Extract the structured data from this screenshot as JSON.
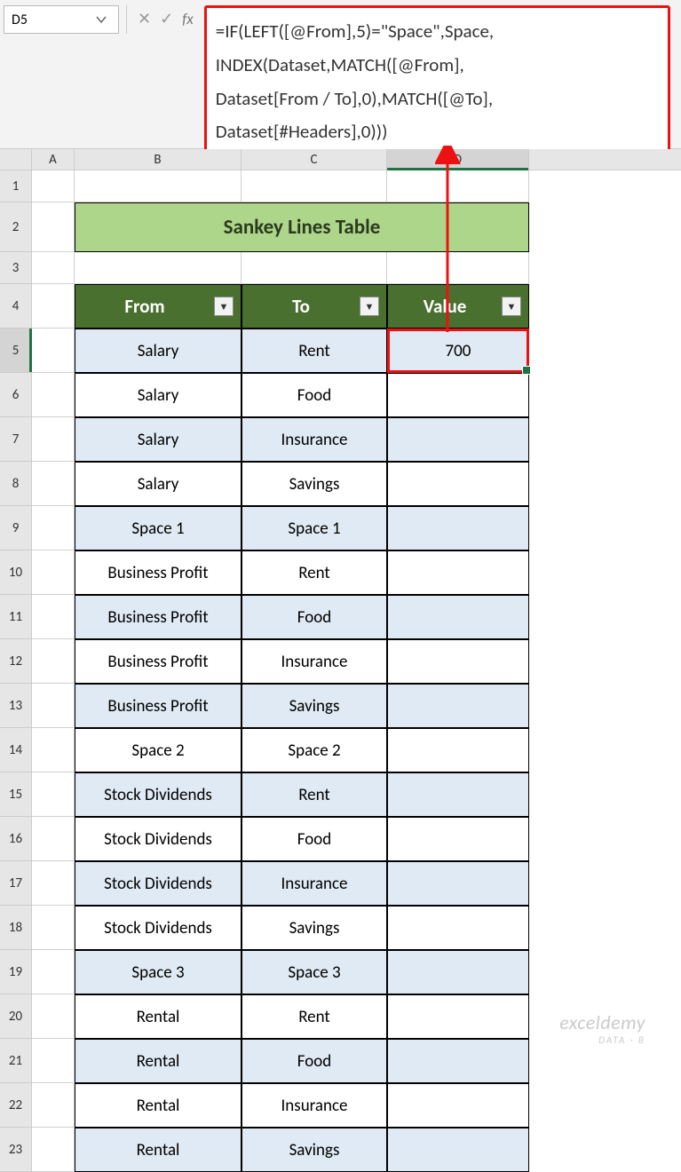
{
  "namebox": {
    "cell_ref": "D5"
  },
  "fx": {
    "cancel": "✕",
    "confirm": "✓",
    "label": "fx"
  },
  "formula": {
    "line1": "=IF(LEFT([@From],5)=\"Space\",Space,",
    "line2": "INDEX(Dataset,MATCH([@From],",
    "line3": "Dataset[From / To],0),MATCH([@To],",
    "line4": "Dataset[#Headers],0)))"
  },
  "cols": {
    "A": "A",
    "B": "B",
    "C": "C",
    "D": "D"
  },
  "row_labels": [
    "1",
    "2",
    "3",
    "4",
    "5",
    "6",
    "7",
    "8",
    "9",
    "10",
    "11",
    "12",
    "13",
    "14",
    "15",
    "16",
    "17",
    "18",
    "19",
    "20",
    "21",
    "22",
    "23"
  ],
  "banner": "Sankey Lines Table",
  "headers": {
    "from": "From",
    "to": "To",
    "value": "Value"
  },
  "rows": [
    {
      "from": "Salary",
      "to": "Rent",
      "value": "700",
      "band": true
    },
    {
      "from": "Salary",
      "to": "Food",
      "value": "",
      "band": false
    },
    {
      "from": "Salary",
      "to": "Insurance",
      "value": "",
      "band": true
    },
    {
      "from": "Salary",
      "to": "Savings",
      "value": "",
      "band": false
    },
    {
      "from": "Space 1",
      "to": "Space 1",
      "value": "",
      "band": true
    },
    {
      "from": "Business Profit",
      "to": "Rent",
      "value": "",
      "band": false
    },
    {
      "from": "Business Profit",
      "to": "Food",
      "value": "",
      "band": true
    },
    {
      "from": "Business Profit",
      "to": "Insurance",
      "value": "",
      "band": false
    },
    {
      "from": "Business Profit",
      "to": "Savings",
      "value": "",
      "band": true
    },
    {
      "from": "Space 2",
      "to": "Space 2",
      "value": "",
      "band": false
    },
    {
      "from": "Stock Dividends",
      "to": "Rent",
      "value": "",
      "band": true
    },
    {
      "from": "Stock Dividends",
      "to": "Food",
      "value": "",
      "band": false
    },
    {
      "from": "Stock Dividends",
      "to": "Insurance",
      "value": "",
      "band": true
    },
    {
      "from": "Stock Dividends",
      "to": "Savings",
      "value": "",
      "band": false
    },
    {
      "from": "Space 3",
      "to": "Space 3",
      "value": "",
      "band": true
    },
    {
      "from": "Rental",
      "to": "Rent",
      "value": "",
      "band": false
    },
    {
      "from": "Rental",
      "to": "Food",
      "value": "",
      "band": true
    },
    {
      "from": "Rental",
      "to": "Insurance",
      "value": "",
      "band": false
    },
    {
      "from": "Rental",
      "to": "Savings",
      "value": "",
      "band": true
    }
  ],
  "watermark": {
    "main": "exceldemy",
    "sub": "DATA · B"
  }
}
